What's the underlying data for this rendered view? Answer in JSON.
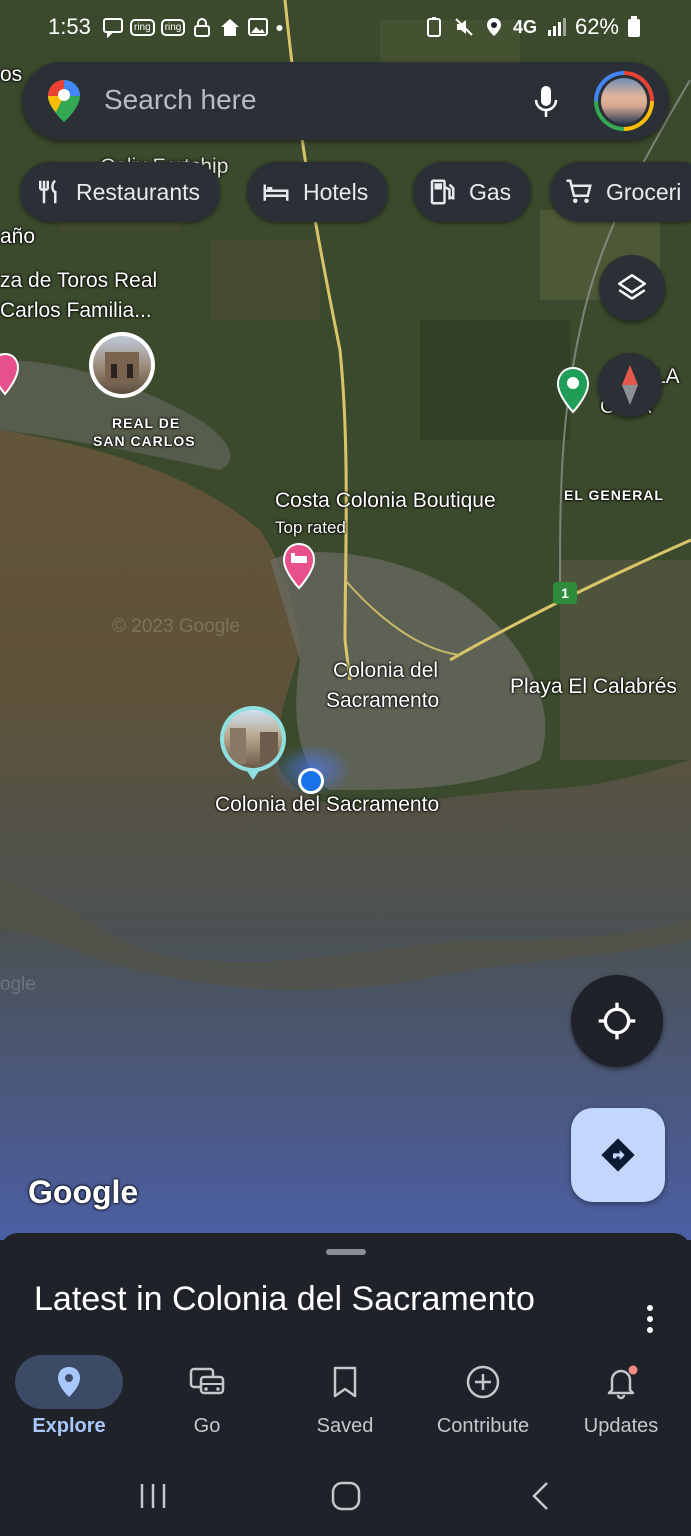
{
  "status_bar": {
    "time": "1:53",
    "left_badges": [
      "ring",
      "ring"
    ],
    "network": "4G",
    "battery": "62%"
  },
  "search": {
    "placeholder": "Search here",
    "icons": [
      "google-maps-pin-icon",
      "mic-icon",
      "avatar"
    ]
  },
  "chips": [
    {
      "label": "Restaurants",
      "icon": "fork-knife-icon"
    },
    {
      "label": "Hotels",
      "icon": "bed-icon"
    },
    {
      "label": "Gas",
      "icon": "gas-pump-icon"
    },
    {
      "label": "Groceri",
      "icon": "cart-icon"
    }
  ],
  "map": {
    "labels": {
      "os": "os",
      "calix": "Calix Fortship",
      "ano": "año",
      "toros_1": "za de Toros Real",
      "toros_2": "Carlos Familia...",
      "real_1": "REAL DE",
      "real_2": "SAN CARLOS",
      "pla_1": "PLA",
      "pla_2": "ONIA",
      "costa": "Costa Colonia Boutique",
      "toprated": "Top rated",
      "elgeneral": "EL GENERAL",
      "route": "1",
      "colonia_1": "Colonia del",
      "colonia_2": "Sacramento",
      "playa": "Playa El Calabrés",
      "colonia_main": "Colonia del Sacramento",
      "copyright": "© 2023 Google",
      "ogle": "ogle",
      "google": "Google"
    },
    "colors": {
      "water": "#6b5a3c",
      "land": "#3b4a2c",
      "my_location": "#1a73e8",
      "directions_button": "#c2d7fb"
    }
  },
  "sheet": {
    "title": "Latest in Colonia del Sacramento"
  },
  "bottom_nav": [
    {
      "label": "Explore",
      "icon": "explore-pin-icon",
      "active": true
    },
    {
      "label": "Go",
      "icon": "car-icon",
      "active": false
    },
    {
      "label": "Saved",
      "icon": "bookmark-icon",
      "active": false
    },
    {
      "label": "Contribute",
      "icon": "plus-circle-icon",
      "active": false
    },
    {
      "label": "Updates",
      "icon": "bell-icon",
      "active": false
    }
  ],
  "system_nav": [
    "recents-icon",
    "home-icon",
    "back-icon"
  ]
}
